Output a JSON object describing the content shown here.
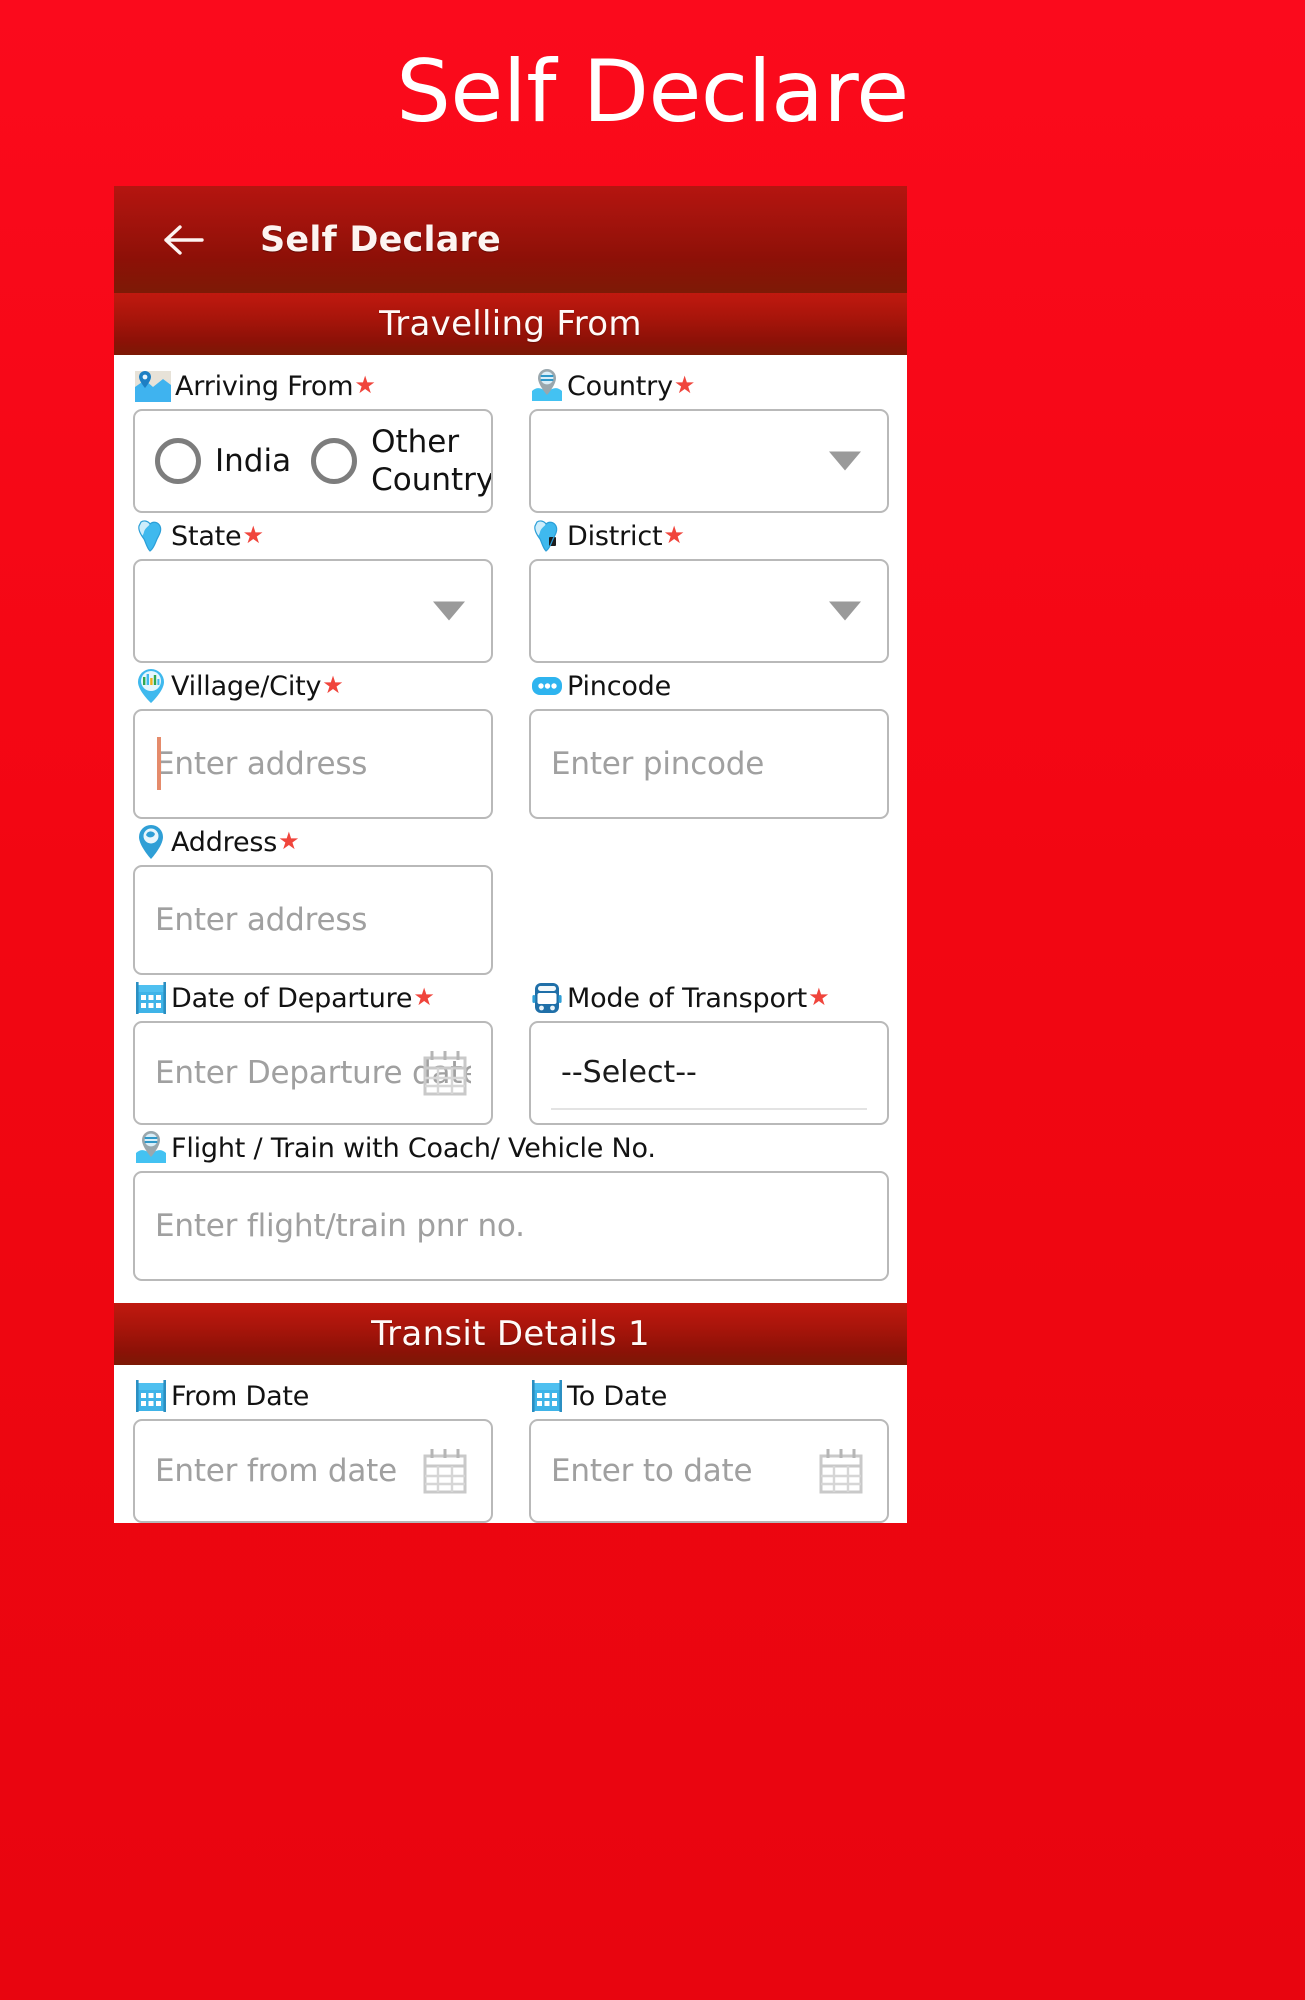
{
  "page": {
    "title": "Self Declare",
    "accent_red": "#f20612",
    "bar_dark_red": "#8d1007",
    "required_star_color": "#f0453c"
  },
  "app_bar": {
    "title": "Self Declare",
    "back_icon": "arrow-left-icon"
  },
  "sections": [
    {
      "id": "travelling-from",
      "band_label": "Travelling From",
      "fields": {
        "arriving_from": {
          "label": "Arriving From",
          "required": true,
          "icon": "map-pin-puzzle-icon",
          "options": [
            {
              "label": "India",
              "selected": false
            },
            {
              "label": "Other Country",
              "selected": false
            }
          ]
        },
        "country": {
          "label": "Country",
          "required": true,
          "icon": "globe-pin-icon",
          "value": "",
          "control": "dropdown"
        },
        "state": {
          "label": "State",
          "required": true,
          "icon": "india-map-icon",
          "value": "",
          "control": "dropdown"
        },
        "district": {
          "label": "District",
          "required": true,
          "icon": "india-map-icon",
          "value": "",
          "control": "dropdown"
        },
        "village_city": {
          "label": "Village/City",
          "required": true,
          "icon": "city-pin-icon",
          "value": "",
          "placeholder": "Enter address",
          "focused": true
        },
        "pincode": {
          "label": "Pincode",
          "required": false,
          "icon": "dots-bubble-icon",
          "value": "",
          "placeholder": "Enter pincode"
        },
        "address": {
          "label": "Address",
          "required": true,
          "icon": "location-pin-icon",
          "value": "",
          "placeholder": "Enter address"
        },
        "date_of_departure": {
          "label": "Date of Departure",
          "required": true,
          "icon": "calendar-icon",
          "value": "",
          "placeholder": "Enter Departure date",
          "trailing_icon": "calendar-picker-icon"
        },
        "mode_of_transport": {
          "label": "Mode of Transport",
          "required": true,
          "icon": "bus-icon",
          "value": "--Select--",
          "control": "select"
        },
        "flight_train_no": {
          "label": "Flight / Train with Coach/ Vehicle No.",
          "required": false,
          "icon": "globe-pin-icon",
          "value": "",
          "placeholder": "Enter flight/train pnr no."
        }
      }
    },
    {
      "id": "transit-details-1",
      "band_label": "Transit Details 1",
      "fields": {
        "from_date": {
          "label": "From Date",
          "required": false,
          "icon": "calendar-icon",
          "value": "",
          "placeholder": "Enter from date",
          "trailing_icon": "calendar-picker-icon"
        },
        "to_date": {
          "label": "To Date",
          "required": false,
          "icon": "calendar-icon",
          "value": "",
          "placeholder": "Enter to date",
          "trailing_icon": "calendar-picker-icon"
        }
      }
    }
  ]
}
